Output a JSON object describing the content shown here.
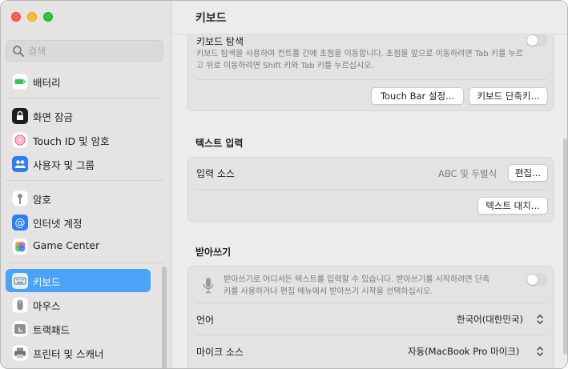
{
  "sidebar": {
    "search_placeholder": "검색",
    "items": [
      {
        "label": "배터리",
        "icon": "battery-icon",
        "color": "#34c759"
      },
      {
        "label": "화면 잠금",
        "icon": "lock-icon",
        "color": "#1d1d1f"
      },
      {
        "label": "Touch ID 및 암호",
        "icon": "fingerprint-icon",
        "color": "#ff3b5c"
      },
      {
        "label": "사용자 및 그룹",
        "icon": "users-icon",
        "color": "#2e7cf6"
      },
      {
        "label": "암호",
        "icon": "key-icon",
        "color": "#8e8e93"
      },
      {
        "label": "인터넷 계정",
        "icon": "at-icon",
        "color": "#2e7cf6"
      },
      {
        "label": "Game Center",
        "icon": "game-center-icon",
        "color": "#ff9500"
      },
      {
        "label": "키보드",
        "icon": "keyboard-icon",
        "color": "#8e8e93"
      },
      {
        "label": "마우스",
        "icon": "mouse-icon",
        "color": "#8e8e93"
      },
      {
        "label": "트랙패드",
        "icon": "trackpad-icon",
        "color": "#8e8e93"
      },
      {
        "label": "프린터 및 스캐너",
        "icon": "printer-icon",
        "color": "#8e8e93"
      }
    ],
    "active_index": 7
  },
  "main": {
    "title": "키보드",
    "nav": {
      "title": "키보드 탐색",
      "description": "키보드 탐색을 사용하여 컨트롤 간에 초점을 이동합니다. 초점을 앞으로 이동하려면 Tab 키를 누르고 뒤로 이동하려면 Shift 키와 Tab 키를 누르십시오.",
      "touchbar_button": "Touch Bar 설정...",
      "shortcuts_button": "키보드 단축키..."
    },
    "text_input": {
      "section_title": "텍스트 입력",
      "source_label": "입력 소스",
      "source_value": "ABC 및 두벌식",
      "edit_button": "편집...",
      "replace_button": "텍스트 대치..."
    },
    "dictation": {
      "section_title": "받아쓰기",
      "description": "받아쓰기로 어디서든 텍스트를 입력할 수 있습니다. 받아쓰기를 시작하려면 단축키를 사용하거나 편집 메뉴에서 받아쓰기 시작을 선택하십시오.",
      "language_label": "언어",
      "language_value": "한국어(대한민국)",
      "mic_label": "마이크 소스",
      "mic_value": "자동(MacBook Pro 마이크)"
    }
  }
}
